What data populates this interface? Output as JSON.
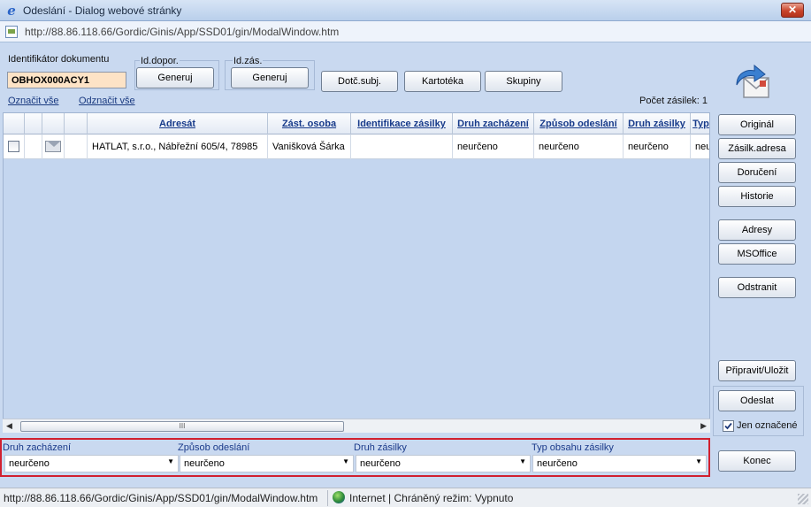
{
  "window": {
    "title": "Odeslání - Dialog webové stránky",
    "close_label": "✕",
    "url": "http://88.86.118.66/Gordic/Ginis/App/SSD01/gin/ModalWindow.htm"
  },
  "form": {
    "doc_id_label": "Identifikátor dokumentu",
    "doc_id_value": "OBHOX000ACY1",
    "id_dopor_label": "Id.dopor.",
    "id_zas_label": "Id.zás.",
    "generate_label": "Generuj",
    "dotc_subj_label": "Dotč.subj.",
    "kartoteka_label": "Kartotéka",
    "skupiny_label": "Skupiny",
    "select_all": "Označit vše",
    "deselect_all": "Odznačit vše",
    "count_text": "Počet zásilek: 1"
  },
  "grid": {
    "columns": [
      "Adresát",
      "Zást. osoba",
      "Identifikace zásilky",
      "Druh zacházení",
      "Způsob odeslání",
      "Druh zásilky",
      "Typ"
    ],
    "rows": [
      {
        "adresat": "HATLAT, s.r.o., Nábřežní 605/4, 78985",
        "zast_osoba": "Vanišková Šárka",
        "identifikace": "",
        "druh_zachazeni": "neurčeno",
        "zpusob_odeslani": "neurčeno",
        "druh_zasilky": "neurčeno",
        "typ": "neu"
      }
    ],
    "scroll_left": "◀",
    "scroll_right": "▶",
    "scroll_thumb": "III"
  },
  "side": {
    "original": "Originál",
    "zasilk_adresa": "Zásilk.adresa",
    "doruceni": "Doručení",
    "historie": "Historie",
    "adresy": "Adresy",
    "msoffice": "MSOffice",
    "odstranit": "Odstranit",
    "pripravit_ulozit": "Připravit/Uložit",
    "odeslat": "Odeslat",
    "jen_oznacene": "Jen označené",
    "jen_oznacene_checked": true,
    "konec": "Konec"
  },
  "filters": [
    {
      "label": "Druh zacházení",
      "value": "neurčeno"
    },
    {
      "label": "Způsob odeslání",
      "value": "neurčeno"
    },
    {
      "label": "Druh zásilky",
      "value": "neurčeno"
    },
    {
      "label": "Typ obsahu zásilky",
      "value": "neurčeno"
    }
  ],
  "status": {
    "url": "http://88.86.118.66/Gordic/Ginis/App/SSD01/gin/ModalWindow.htm",
    "zone": "Internet | Chráněný režim: Vypnuto"
  },
  "colors": {
    "background": "#c9d9f0",
    "doc_id_fill": "#fde3c6",
    "highlight_border": "#d1202f",
    "link": "#1a3a80"
  }
}
